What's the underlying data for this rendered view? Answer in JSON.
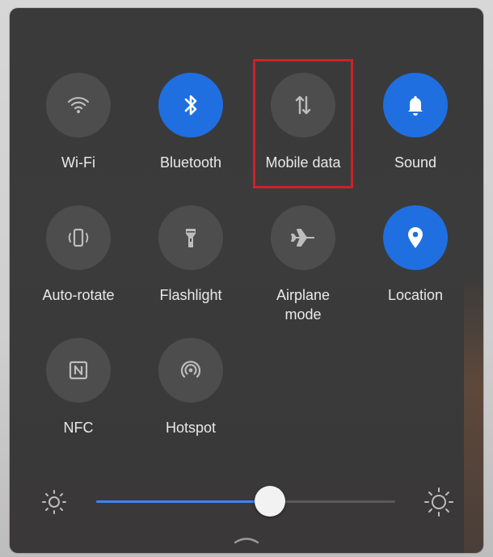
{
  "quick_settings": {
    "tiles": [
      {
        "id": "wifi",
        "label": "Wi-Fi",
        "active": false,
        "icon": "wifi-icon"
      },
      {
        "id": "bluetooth",
        "label": "Bluetooth",
        "active": true,
        "icon": "bluetooth-icon"
      },
      {
        "id": "mobile-data",
        "label": "Mobile data",
        "active": false,
        "icon": "mobile-data-icon"
      },
      {
        "id": "sound",
        "label": "Sound",
        "active": true,
        "icon": "bell-icon"
      },
      {
        "id": "auto-rotate",
        "label": "Auto-rotate",
        "active": false,
        "icon": "auto-rotate-icon"
      },
      {
        "id": "flashlight",
        "label": "Flashlight",
        "active": false,
        "icon": "flashlight-icon"
      },
      {
        "id": "airplane",
        "label": "Airplane\nmode",
        "active": false,
        "icon": "airplane-icon"
      },
      {
        "id": "location",
        "label": "Location",
        "active": true,
        "icon": "location-pin-icon"
      },
      {
        "id": "nfc",
        "label": "NFC",
        "active": false,
        "icon": "nfc-icon"
      },
      {
        "id": "hotspot",
        "label": "Hotspot",
        "active": false,
        "icon": "hotspot-icon"
      }
    ]
  },
  "brightness": {
    "level": 0.58,
    "min_icon": "brightness-low-icon",
    "max_icon": "brightness-high-icon"
  },
  "colors": {
    "panel_bg": "#3a3a3a",
    "tile_inactive": "#4d4d4d",
    "tile_active": "#1f6fe0",
    "highlight": "#d0202a",
    "slider_fill": "#3a86ee"
  },
  "handle_icon": "drag-handle-icon"
}
